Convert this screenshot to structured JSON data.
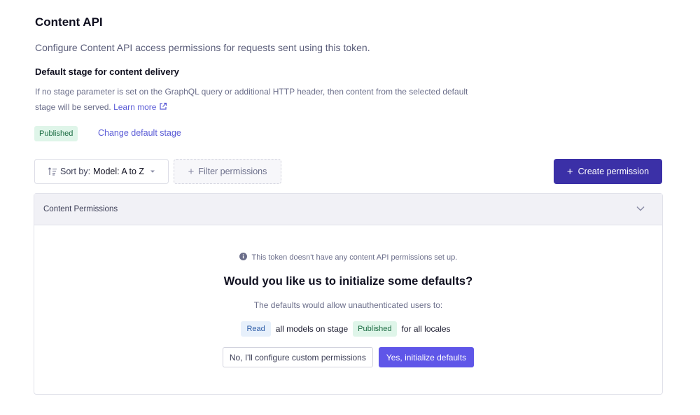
{
  "header": {
    "title": "Content API",
    "description": "Configure Content API access permissions for requests sent using this token."
  },
  "stage": {
    "title": "Default stage for content delivery",
    "help_text": "If no stage parameter is set on the GraphQL query or additional HTTP header, then content from the selected default stage will be served.",
    "learn_more": "Learn more",
    "badge": "Published",
    "change_label": "Change default stage"
  },
  "toolbar": {
    "sort_prefix": "Sort by:",
    "sort_value": "Model: A to Z",
    "filter_label": "Filter permissions",
    "create_label": "Create permission"
  },
  "panel": {
    "header": "Content Permissions",
    "info": "This token doesn't have any content API permissions set up.",
    "question": "Would you like us to initialize some defaults?",
    "defaults_desc": "The defaults would allow unauthenticated users to:",
    "perm": {
      "action_badge": "Read",
      "text_models": "all models on stage",
      "stage_badge": "Published",
      "text_locales": "for all locales"
    },
    "secondary_button": "No, I'll configure custom permissions",
    "primary_button": "Yes, initialize defaults"
  },
  "colors": {
    "accent": "#3b30a7",
    "primary_button": "#5f56e8",
    "link": "#5b5cd6",
    "published_bg": "#dff5e9",
    "read_bg": "#e7f0fb"
  },
  "icons": [
    "external-link-icon",
    "sort-icon",
    "caret-down-icon",
    "plus-icon",
    "chevron-down-icon",
    "info-icon"
  ]
}
